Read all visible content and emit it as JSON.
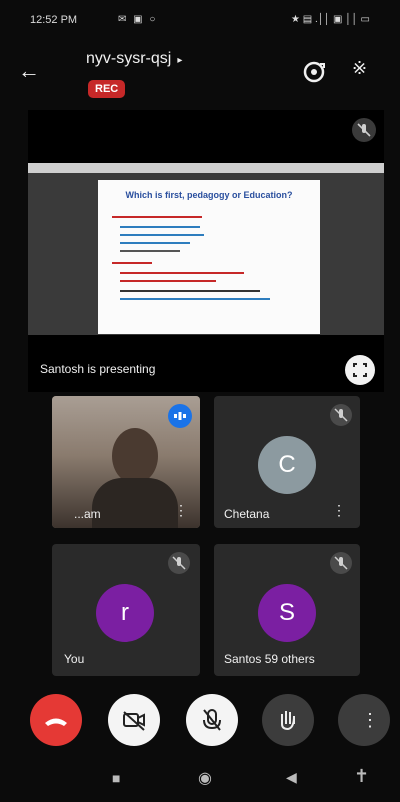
{
  "status": {
    "time": "12:52 PM",
    "left_icons": "✉ ▣ ○",
    "right_icons": "★ ▤ .││ ▣ ││ ▭"
  },
  "header": {
    "back_icon": "arrow-left",
    "meeting_code": "nyv-sysr-qsj",
    "caret": "▸",
    "rec_label": "REC",
    "icons": [
      "camera-switch",
      "bluetooth"
    ]
  },
  "presentation": {
    "slide_title": "Which is first, pedagogy or Education?",
    "presenting_text": "Santosh is presenting"
  },
  "tiles": [
    {
      "name": "...am",
      "type": "video"
    },
    {
      "name": "Chetana",
      "initial": "C",
      "color": "#8c9aa0"
    },
    {
      "name": "You",
      "initial": "r",
      "color": "#7b1fa2"
    },
    {
      "name": "Santos  59 others",
      "initial": "S",
      "color": "#7b1fa2"
    }
  ],
  "controls": [
    "end-call",
    "camera-off",
    "mic-off",
    "raise-hand",
    "more"
  ],
  "colors": {
    "end_call": "#e53935",
    "rec": "#c62828",
    "accent": "#1a73e8"
  }
}
